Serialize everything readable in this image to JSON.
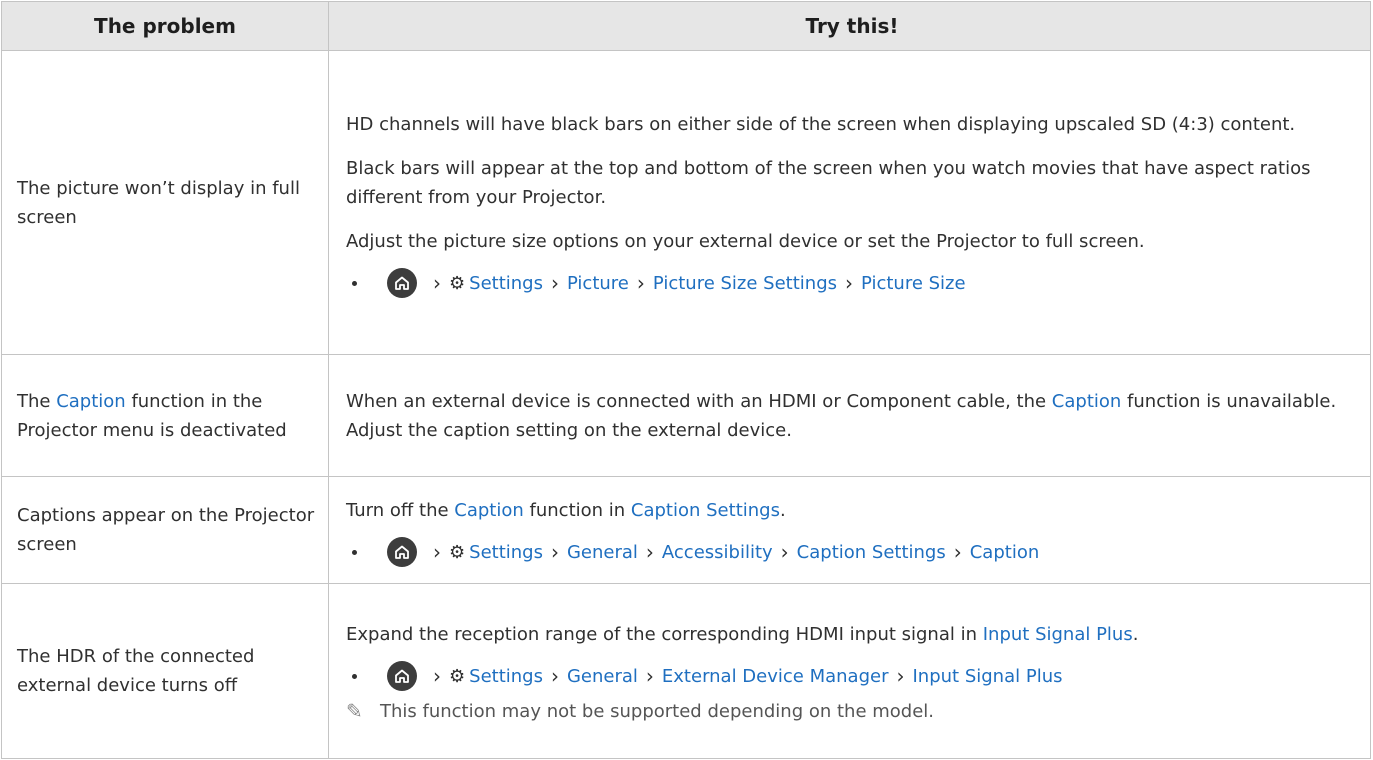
{
  "header": {
    "col1": "The problem",
    "col2": "Try this!"
  },
  "rows": {
    "r1": {
      "problem": "The picture won’t display in full screen",
      "p1": "HD channels will have black bars on either side of the screen when displaying upscaled SD (4:3) content.",
      "p2": "Black bars will appear at the top and bottom of the screen when you watch movies that have aspect ratios different from your Projector.",
      "p3": "Adjust the picture size options on your external device or set the Projector to full screen.",
      "path": [
        "Settings",
        "Picture",
        "Picture Size Settings",
        "Picture Size"
      ]
    },
    "r2": {
      "problem_pre": "The ",
      "problem_link": "Caption",
      "problem_post": " function in the Projector menu is deactivated",
      "text_pre": "When an external device is connected with an HDMI or Component cable, the ",
      "text_link": "Caption",
      "text_post": " function is unavailable. Adjust the caption setting on the external device."
    },
    "r3": {
      "problem": "Captions appear on the Projector screen",
      "text_pre": "Turn off the ",
      "text_link1": "Caption",
      "text_mid": " function in ",
      "text_link2": "Caption Settings",
      "text_post": ".",
      "path": [
        "Settings",
        "General",
        "Accessibility",
        "Caption Settings",
        "Caption"
      ]
    },
    "r4": {
      "problem": "The HDR of the connected external device turns off",
      "text_pre": "Expand the reception range of the corresponding HDMI input signal in ",
      "text_link": "Input Signal Plus",
      "text_post": ".",
      "path": [
        "Settings",
        "General",
        "External Device Manager",
        "Input Signal Plus"
      ],
      "note": "This function may not be supported depending on the model."
    }
  },
  "icons": {
    "home": "home-icon",
    "settings": "gear-icon",
    "separator": "chevron-right-icon",
    "note": "pencil-note-icon"
  },
  "colors": {
    "link": "#1f6fc0",
    "header_bg": "#e6e6e6",
    "border": "#c4c4c4"
  }
}
